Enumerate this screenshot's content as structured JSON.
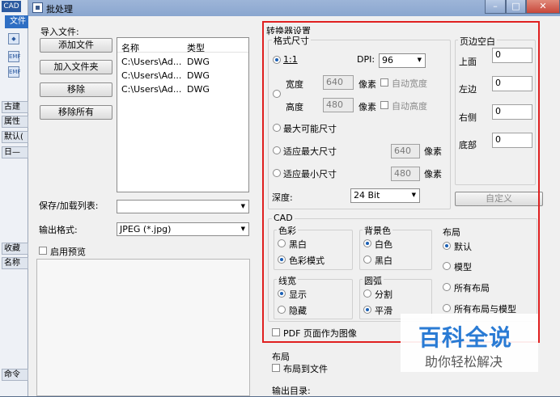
{
  "app": {
    "logo": "CAD",
    "tab": "文件",
    "icon_labels": [
      "EMF",
      "EMF"
    ]
  },
  "bg_labels": [
    "古建",
    "属性",
    "默认(",
    "日—",
    "收藏",
    "名称",
    "命令"
  ],
  "dialog": {
    "title": "批处理"
  },
  "window_controls": [
    "minimize-icon",
    "maximize-icon",
    "close-icon"
  ],
  "import": {
    "label": "导入文件:",
    "buttons": [
      "添加文件",
      "加入文件夹",
      "移除",
      "移除所有"
    ],
    "columns": [
      "名称",
      "类型"
    ],
    "rows": [
      {
        "name": "C:\\Users\\Ad...",
        "type": "DWG"
      },
      {
        "name": "C:\\Users\\Ad...",
        "type": "DWG"
      },
      {
        "name": "C:\\Users\\Ad...",
        "type": "DWG"
      }
    ],
    "save_load_label": "保存/加载列表:",
    "save_load_value": "",
    "output_format_label": "输出格式:",
    "output_format_value": "JPEG (*.jpg)",
    "preview_label": "启用预览",
    "preview_checked": false
  },
  "converter": {
    "title": "转换器设置",
    "format_title": "格式尺寸",
    "ratio_label": "1:1",
    "dpi_label": "DPI:",
    "dpi_value": "96",
    "width_label": "宽度",
    "width_value": "640",
    "height_label": "高度",
    "height_value": "480",
    "pixel_label": "像素",
    "auto_width": "自动宽度",
    "auto_height": "自动高度",
    "max_possible": "最大可能尺寸",
    "fit_max": "适应最大尺寸",
    "fit_max_value": "640",
    "fit_min": "适应最小尺寸",
    "fit_min_value": "480",
    "depth_label": "深度:",
    "depth_value": "24 Bit",
    "margin_title": "页边空白",
    "margins": [
      {
        "label": "上面",
        "value": "0"
      },
      {
        "label": "左边",
        "value": "0"
      },
      {
        "label": "右侧",
        "value": "0"
      },
      {
        "label": "底部",
        "value": "0"
      }
    ],
    "custom_button": "自定义",
    "cad_title": "CAD",
    "color_title": "色彩",
    "color_options": [
      "黑白",
      "色彩模式"
    ],
    "color_selected": 1,
    "bgcolor_title": "背景色",
    "bgcolor_options": [
      "白色",
      "黑白"
    ],
    "bgcolor_selected": 0,
    "layout_title": "布局",
    "layout_options": [
      "默认",
      "模型",
      "所有布局",
      "所有布局与模型"
    ],
    "layout_selected": 0,
    "lineweight_title": "线宽",
    "lineweight_options": [
      "显示",
      "隐藏"
    ],
    "lineweight_selected": 0,
    "arc_title": "圆弧",
    "arc_options": [
      "分割",
      "平滑"
    ],
    "arc_selected": 1,
    "pdf_label": "PDF 页面作为图像"
  },
  "lower": {
    "layout_title": "布局",
    "layout_to_file": "布局到文件",
    "output_dir_label": "输出目录:"
  },
  "watermark": {
    "title": "百科全说",
    "subtitle": "助你轻松解决"
  },
  "colors": {
    "highlight": "#e02020",
    "titlebar": "#9db5d8",
    "close": "#c8473a"
  }
}
